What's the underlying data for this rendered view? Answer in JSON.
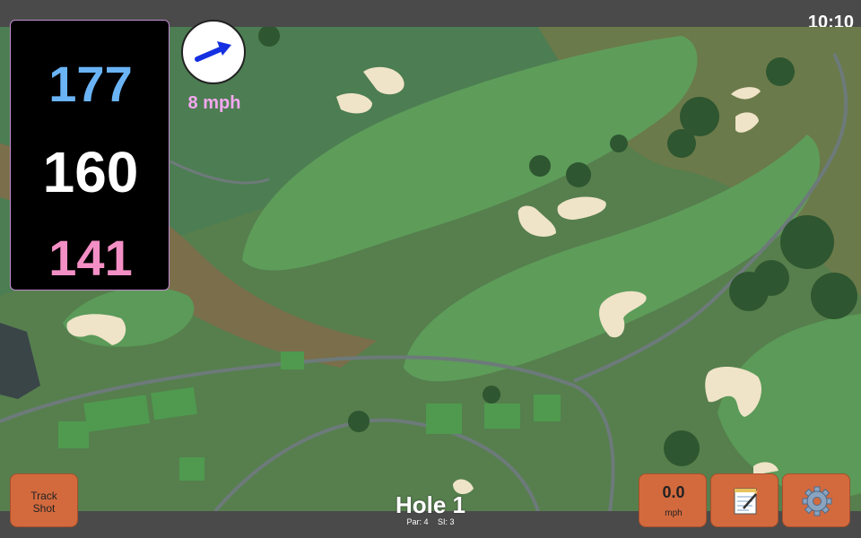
{
  "status_bar": {
    "time": "10:10"
  },
  "distances": {
    "back": "177",
    "middle": "160",
    "front": "141"
  },
  "wind": {
    "speed": "8 mph",
    "icon": "wind-arrow-icon"
  },
  "hole": {
    "title": "Hole 1",
    "par": "Par: 4",
    "si": "SI: 3"
  },
  "buttons": {
    "track_shot_line1": "Track",
    "track_shot_line2": "Shot",
    "speed_value": "0.0",
    "speed_unit": "mph",
    "notes_icon": "notepad-icon",
    "settings_icon": "gear-icon"
  },
  "colors": {
    "back_distance": "#6ab4f6",
    "middle_distance": "#ffffff",
    "front_distance": "#f48fc6",
    "wind_text": "#f5a8f0",
    "button": "#d36a3e"
  }
}
